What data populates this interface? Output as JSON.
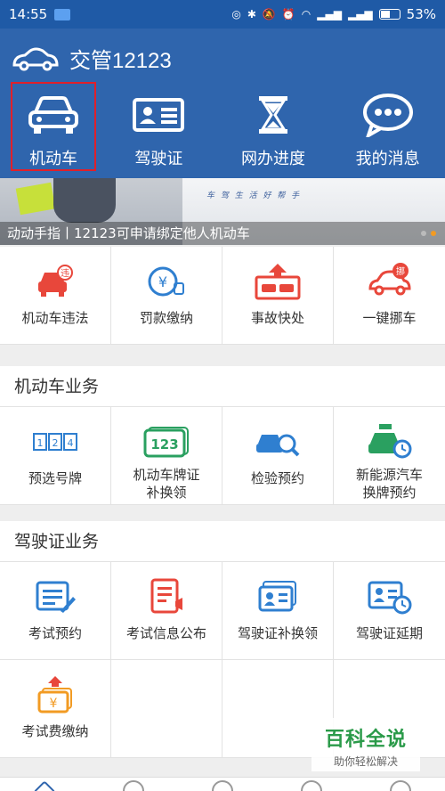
{
  "status_bar": {
    "time": "14:55",
    "battery": "53%"
  },
  "header": {
    "app_title": "交管12123",
    "nav": [
      {
        "label": "机动车",
        "icon": "car-front-icon",
        "selected": true
      },
      {
        "label": "驾驶证",
        "icon": "license-card-icon",
        "selected": false
      },
      {
        "label": "网办进度",
        "icon": "hourglass-icon",
        "selected": false
      },
      {
        "label": "我的消息",
        "icon": "chat-bubble-icon",
        "selected": false
      }
    ]
  },
  "banner": {
    "slogan": "车 驾 生 活 好 帮 手",
    "caption": "动动手指丨12123可申请绑定他人机动车",
    "slides": 2,
    "active_slide": 2
  },
  "quick_actions": [
    {
      "label": "机动车违法",
      "icon": "car-violation-icon"
    },
    {
      "label": "罚款缴纳",
      "icon": "fine-payment-icon"
    },
    {
      "label": "事故快处",
      "icon": "accident-icon"
    },
    {
      "label": "一键挪车",
      "icon": "move-car-icon"
    }
  ],
  "vehicle_section": {
    "title": "机动车业务",
    "items": [
      {
        "label": "预选号牌",
        "icon": "plate-select-icon"
      },
      {
        "label": "机动车牌证\n补换领",
        "icon": "plate-replace-icon"
      },
      {
        "label": "检验预约",
        "icon": "inspection-icon"
      },
      {
        "label": "新能源汽车\n换牌预约",
        "icon": "new-energy-icon"
      }
    ]
  },
  "license_section": {
    "title": "驾驶证业务",
    "items": [
      {
        "label": "考试预约",
        "icon": "exam-booking-icon"
      },
      {
        "label": "考试信息公布",
        "icon": "exam-info-icon"
      },
      {
        "label": "驾驶证补换领",
        "icon": "license-replace-icon"
      },
      {
        "label": "驾驶证延期",
        "icon": "license-extend-icon"
      },
      {
        "label": "考试费缴纳",
        "icon": "exam-fee-icon"
      }
    ]
  },
  "watermark": {
    "big": "百科全说",
    "small": "助你轻松解决"
  },
  "colors": {
    "header_bg": "#2f65ad",
    "red": "#e8473b",
    "blue": "#2f7fd0",
    "green": "#2aa060",
    "orange": "#f29b23"
  }
}
